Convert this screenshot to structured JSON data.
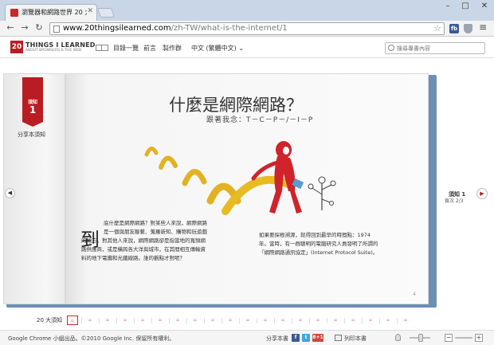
{
  "browser": {
    "tab_title": "瀏覽器和網路世界 20 大…",
    "url_host": "www.20thingsilearned.com",
    "url_path": "/zh-TW/what-is-the-internet/1",
    "window_controls": {
      "minimize": "–",
      "maximize": "□",
      "close": "✕"
    },
    "ext_fb_label": "fb"
  },
  "site": {
    "logo_mark": "20",
    "logo_title": "THINGS I LEARNED",
    "logo_subtitle": "ABOUT BROWSERS & THE WEB",
    "nav": [
      "目錄一覽",
      "前言",
      "製作群"
    ],
    "language": "中文 (繁體中文)",
    "search_placeholder": "搜尋專書內容"
  },
  "book": {
    "ribbon_label": "須知",
    "ribbon_number": "1",
    "ribbon_caption": "分享本須知",
    "title": "什麼是網際網路？",
    "subtitle": "跟著我念：T－C－P－/－I－P",
    "dropcap": "到",
    "para_left": [
      "底什麼是網際網路？對某些人來說，網際網路",
      "是一個與朋友聯繫、蒐羅新知、購物和玩遊戲",
      "的地方。對其他人來說，網際網路卻是指當地的寬頻網",
      "路供應商，或是橫跨各大洋與城市，在其間相互傳輸資",
      "料的地下電纜和光纖線路。誰的觀點才對呢？"
    ],
    "para_right": [
      "如果要探根溯源，就得回到最早的時間點：1974",
      "年。當時，有一群聰明的電腦研究人員發明了所謂的",
      "「網際網路通訊協定」(Internet Protocol Suite)。"
    ],
    "page_number": "4",
    "side_chapter_title": "須知 1",
    "side_page_info": "頁次 2/3"
  },
  "chapter_nav": {
    "label": "20 大須知"
  },
  "footer": {
    "copyright": "Google Chrome 小組出品。©2010 Google Inc. 保留所有權利。",
    "share_label": "分享本書",
    "social": [
      "f",
      "t",
      "8+1"
    ],
    "print_label": "列印本書",
    "zoom_minus": "−",
    "zoom_plus": "+"
  }
}
